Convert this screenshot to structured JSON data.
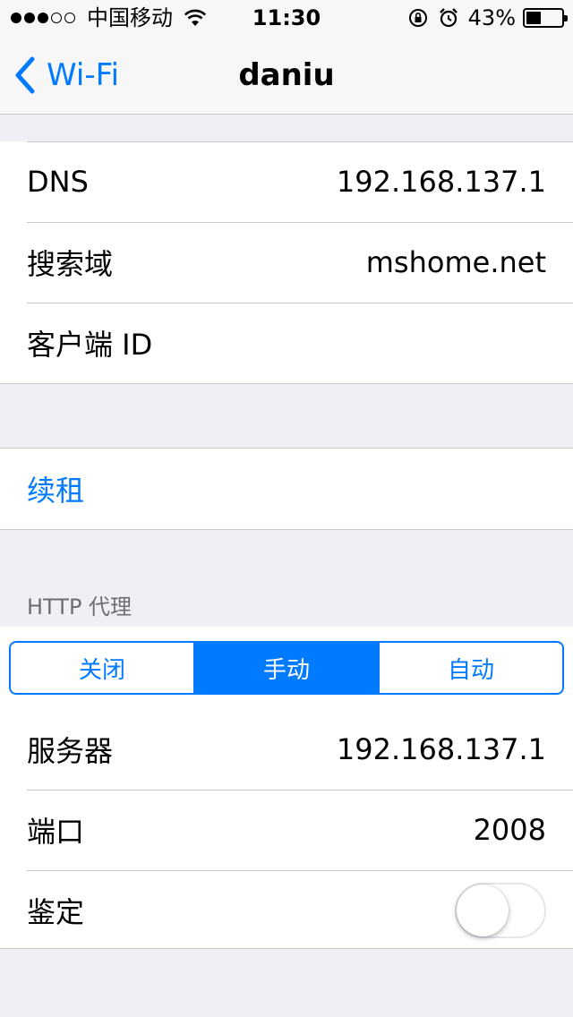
{
  "status_bar": {
    "signal_dots_filled": 3,
    "signal_dots_total": 5,
    "carrier": "中国移动",
    "time": "11:30",
    "battery_percent": "43%",
    "battery_level": 0.43
  },
  "nav": {
    "back_label": "Wi-Fi",
    "title": "daniu"
  },
  "dhcp_rows": [
    {
      "label": "DNS",
      "value": "192.168.137.1"
    },
    {
      "label": "搜索域",
      "value": "mshome.net"
    },
    {
      "label": "客户端 ID",
      "value": ""
    }
  ],
  "renew_label": "续租",
  "proxy": {
    "section_header": "HTTP 代理",
    "segments": [
      "关闭",
      "手动",
      "自动"
    ],
    "selected_index": 1,
    "server_label": "服务器",
    "server_value": "192.168.137.1",
    "port_label": "端口",
    "port_value": "2008",
    "auth_label": "鉴定",
    "auth_enabled": false
  },
  "colors": {
    "accent": "#007aff",
    "background": "#efeff4",
    "separator": "#c8c7cc"
  }
}
